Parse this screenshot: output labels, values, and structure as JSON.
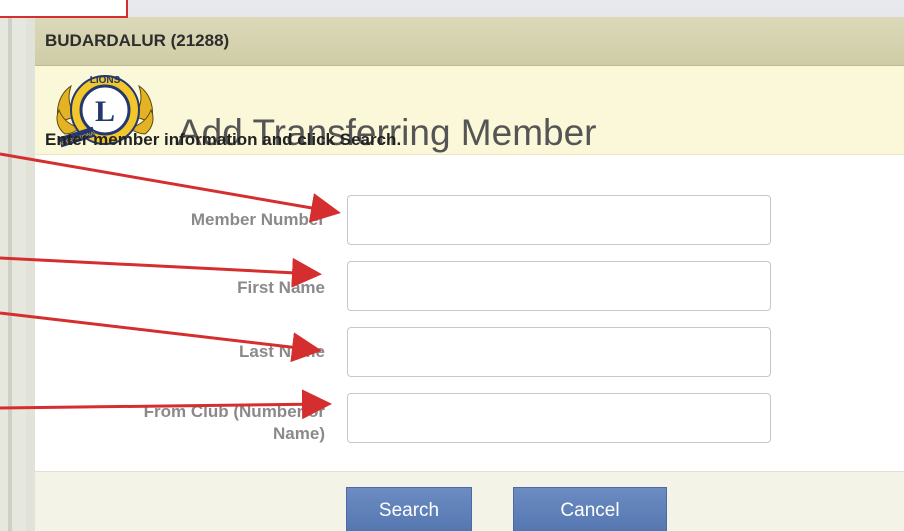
{
  "club": {
    "name": "BUDARDALUR (21288)"
  },
  "logo": {
    "icon": "lions-international-logo-icon",
    "top_text": "LIONS",
    "center_letter": "L",
    "left_text": "INTERNATIONAL"
  },
  "page": {
    "title": "Add Transferring Member",
    "instruction": "Enter member information and click Search."
  },
  "form": {
    "fields": [
      {
        "label": "Member Number",
        "value": ""
      },
      {
        "label": "First Name",
        "value": ""
      },
      {
        "label": "Last Name",
        "value": ""
      },
      {
        "label_line1": "From Club (Number or",
        "label_line2": "Name)",
        "value": ""
      }
    ]
  },
  "actions": {
    "search_label": "Search",
    "cancel_label": "Cancel"
  },
  "colors": {
    "annotation_arrow": "#d42e2e",
    "button": "#5e80b8",
    "club_bar": "#d6d3b0",
    "header_band": "#fbf8da"
  }
}
